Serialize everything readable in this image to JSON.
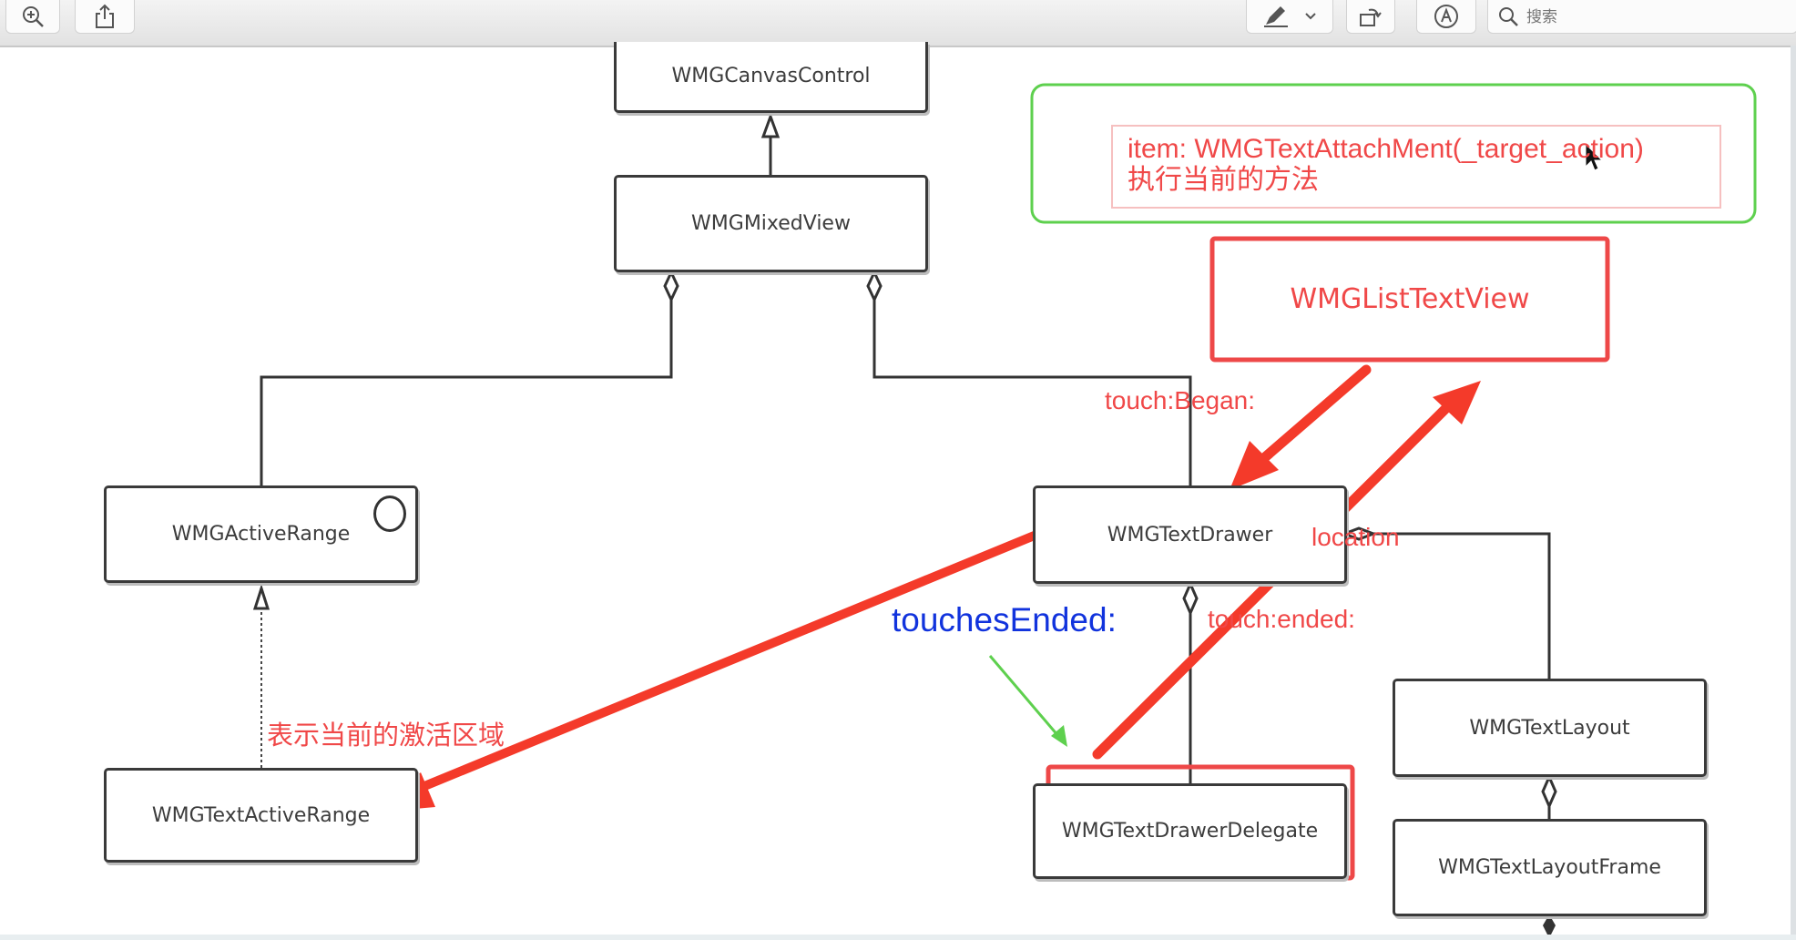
{
  "toolbar": {
    "zoom_icon": "zoom-in-icon",
    "share_icon": "share-icon",
    "pen_icon": "pen-icon",
    "rotate_icon": "rotate-icon",
    "markup_icon": "markup-icon",
    "search_placeholder": "搜索"
  },
  "classes": {
    "canvas_control": "WMGCanvasControl",
    "mixed_view": "WMGMixedView",
    "active_range": "WMGActiveRange",
    "text_drawer": "WMGTextDrawer",
    "text_active_range": "WMGTextActiveRange",
    "text_drawer_delegate": "WMGTextDrawerDelegate",
    "text_layout": "WMGTextLayout",
    "text_layout_frame": "WMGTextLayoutFrame",
    "list_text_view": "WMGListTextView"
  },
  "annotations": {
    "item_note_line1": "item: WMGTextAttachMent(_target_action)",
    "item_note_line2": "执行当前的方法",
    "touch_began": "touch:Began:",
    "touch_ended": "touch:ended:",
    "location": "location",
    "touches_ended": "touchesEnded:",
    "active_area_note": "表示当前的激活区域"
  },
  "colors": {
    "annotation_red": "#f04848",
    "arrow_red": "#f43a2a",
    "note_green": "#5ed04e",
    "blue_text": "#1133dd"
  }
}
